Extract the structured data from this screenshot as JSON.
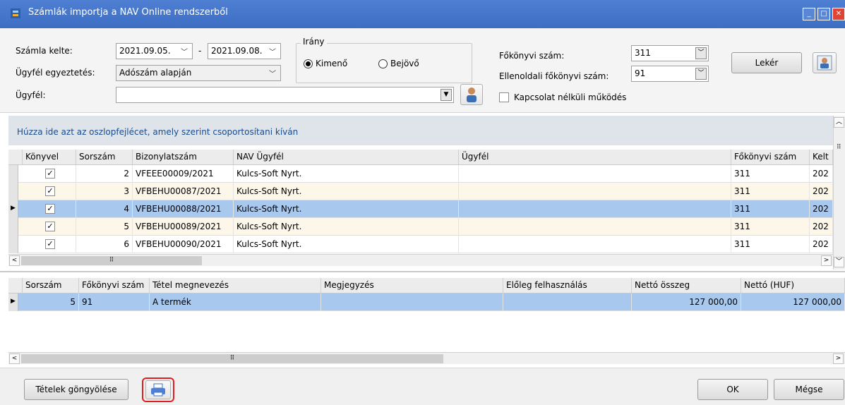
{
  "window": {
    "title": "Számlák importja a NAV Online rendszerből",
    "controls": [
      "minimize",
      "maximize",
      "close"
    ]
  },
  "filters": {
    "date_label": "Számla kelte:",
    "date_from": "2021.09.05.",
    "date_separator": "-",
    "date_to": "2021.09.08.",
    "matching_label": "Ügyfél egyeztetés:",
    "matching_value": "Adószám alapján",
    "customer_label": "Ügyfél:",
    "customer_value": "",
    "direction_title": "Irány",
    "direction_out": "Kimenő",
    "direction_in": "Bejövő",
    "direction_selected": "out",
    "ledger_label": "Főkönyvi szám:",
    "ledger_value": "311",
    "counter_ledger_label": "Ellenoldali főkönyvi szám:",
    "counter_ledger_value": "91",
    "offline_label": "Kapcsolat nélküli működés",
    "offline_checked": false,
    "fetch_label": "Lekér"
  },
  "upper_grid": {
    "group_hint": "Húzza ide azt az oszlopfejlécet, amely szerint csoportosítani kíván",
    "columns": [
      "Könyvel",
      "Sorszám",
      "Bizonylatszám",
      "NAV Ügyfél",
      "Ügyfél",
      "Főkönyvi szám",
      "Kelt"
    ],
    "rows": [
      {
        "book": true,
        "seq": "2",
        "doc": "VFEEE00009/2021",
        "nav_customer": "Kulcs-Soft Nyrt.",
        "customer": "",
        "ledger": "311",
        "date": "202",
        "selected": false
      },
      {
        "book": true,
        "seq": "3",
        "doc": "VFBEHU00087/2021",
        "nav_customer": "Kulcs-Soft Nyrt.",
        "customer": "",
        "ledger": "311",
        "date": "202",
        "selected": false
      },
      {
        "book": true,
        "seq": "4",
        "doc": "VFBEHU00088/2021",
        "nav_customer": "Kulcs-Soft Nyrt.",
        "customer": "",
        "ledger": "311",
        "date": "202",
        "selected": true
      },
      {
        "book": true,
        "seq": "5",
        "doc": "VFBEHU00089/2021",
        "nav_customer": "Kulcs-Soft Nyrt.",
        "customer": "",
        "ledger": "311",
        "date": "202",
        "selected": false
      },
      {
        "book": true,
        "seq": "6",
        "doc": "VFBEHU00090/2021",
        "nav_customer": "Kulcs-Soft Nyrt.",
        "customer": "",
        "ledger": "311",
        "date": "202",
        "selected": false
      }
    ]
  },
  "lower_grid": {
    "columns": [
      "Sorszám",
      "Főkönyvi szám",
      "Tétel megnevezés",
      "Megjegyzés",
      "Előleg felhasználás",
      "Nettó összeg",
      "Nettó (HUF)"
    ],
    "rows": [
      {
        "seq": "5",
        "ledger": "91",
        "item": "A termék",
        "note": "",
        "advance": "",
        "net": "127 000,00",
        "net_huf": "127 000,00"
      }
    ]
  },
  "footer": {
    "rollup_label": "Tételek göngyölése",
    "ok_label": "OK",
    "cancel_label": "Mégse"
  },
  "colors": {
    "titlebar": "#3d6ec4",
    "selected_row": "#a9c8ee",
    "alt_row": "#fdf7ea",
    "highlight_border": "#e02020",
    "hint_text": "#1a4b8c"
  }
}
